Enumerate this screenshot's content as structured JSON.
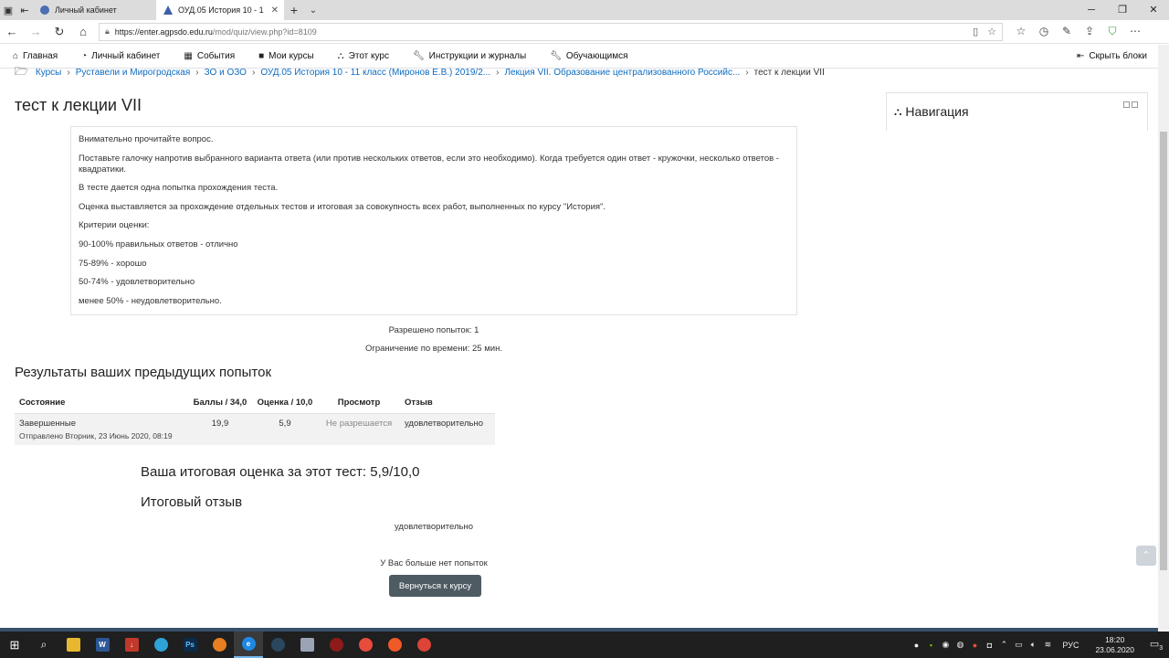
{
  "browser": {
    "tabs": [
      {
        "title": "Личный кабинет",
        "active": false
      },
      {
        "title": "ОУД.05 История 10 - 1",
        "active": true
      }
    ],
    "url_host": "https://enter.agpsdo.edu.ru",
    "url_path": "/mod/quiz/view.php?id=8109"
  },
  "navbar": {
    "items": [
      {
        "label": "Главная",
        "icon": "home-icon"
      },
      {
        "label": "Личный кабинет",
        "icon": "dashboard-icon"
      },
      {
        "label": "События",
        "icon": "calendar-icon"
      },
      {
        "label": "Мои курсы",
        "icon": "courses-icon"
      },
      {
        "label": "Этот курс",
        "icon": "sitemap-icon"
      },
      {
        "label": "Инструкции и журналы",
        "icon": "wrench-icon"
      },
      {
        "label": "Обучающимся",
        "icon": "wrench-icon"
      }
    ],
    "hide_blocks": "Скрыть блоки"
  },
  "breadcrumb": [
    "Курсы",
    "Руставели и Мирогродская",
    "ЗО и ОЗО",
    "ОУД.05 История 10 - 11 класс (Миронов Е.В.) 2019/2...",
    "Лекция VII. Образование централизованного Российс...",
    "тест к лекции VII"
  ],
  "page_title": "тест к лекции VII",
  "intro": [
    "Внимательно прочитайте вопрос.",
    "Поставьте галочку напротив выбранного варианта ответа (или против нескольких ответов, если это необходимо). Когда требуется один ответ - кружочки, несколько ответов - квадратики.",
    "В тесте дается одна попытка прохождения теста.",
    "Оценка выставляется за прохождение отдельных тестов и итоговая за совокупность всех работ, выполненных по курсу \"История\".",
    "Критерии оценки:",
    "90-100% правильных ответов - отлично",
    "75-89% - хорошо",
    "50-74% - удовлетворительно",
    "менее 50% - неудовлетворительно."
  ],
  "quiz_info": {
    "attempts_allowed": "Разрешено попыток: 1",
    "time_limit": "Ограничение по времени: 25 мин."
  },
  "results": {
    "heading": "Результаты ваших предыдущих попыток",
    "columns": [
      "Состояние",
      "Баллы / 34,0",
      "Оценка / 10,0",
      "Просмотр",
      "Отзыв"
    ],
    "row": {
      "state": "Завершенные",
      "submitted": "Отправлено Вторник, 23 Июнь 2020, 08:19",
      "points": "19,9",
      "grade": "5,9",
      "review": "Не разрешается",
      "feedback": "удовлетворительно"
    }
  },
  "final_grade": "Ваша итоговая оценка за этот тест: 5,9/10,0",
  "final_feedback_heading": "Итоговый отзыв",
  "final_feedback": "удовлетворительно",
  "no_more_attempts": "У Вас больше нет попыток",
  "back_button": "Вернуться к курсу",
  "navigation_block_title": "Навигация",
  "taskbar": {
    "lang": "РУС",
    "time": "18:20",
    "date": "23.06.2020",
    "notif_count": "3"
  }
}
